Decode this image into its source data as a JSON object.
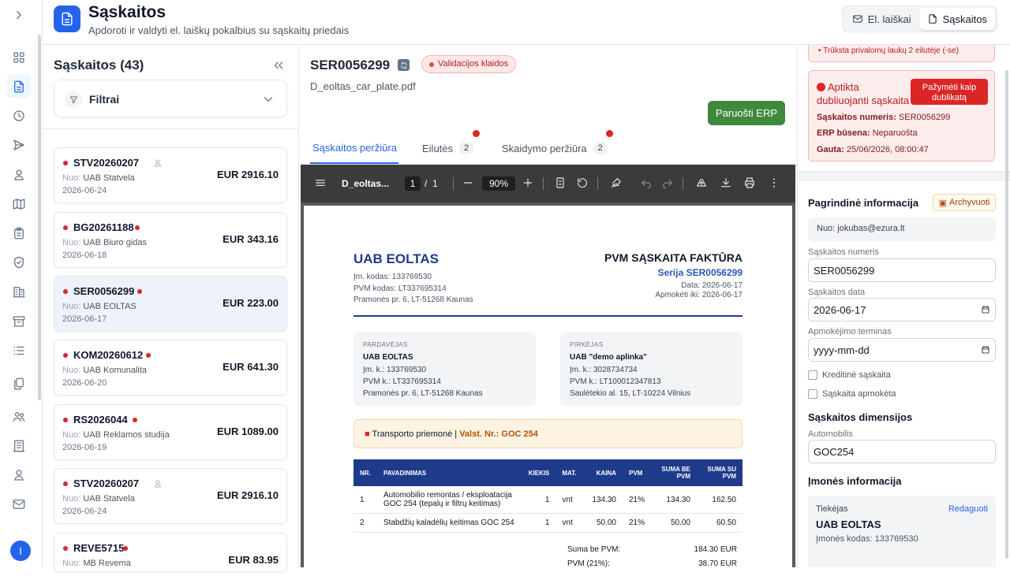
{
  "header": {
    "title": "Sąskaitos",
    "subtitle": "Apdoroti ir valdyti el. laiškų pokalbius su sąskaitų priedais",
    "tabs": [
      "El. laiškai",
      "Sąskaitos"
    ]
  },
  "rail": {
    "icons": [
      "expand-chevron",
      "dashboard",
      "invoices",
      "history",
      "send",
      "user",
      "map",
      "clipboard",
      "shield",
      "buildings",
      "archive",
      "list",
      "documents",
      "users",
      "building",
      "user",
      "mail",
      "menu"
    ],
    "avatar": "I"
  },
  "list": {
    "title": "Sąskaitos (43)",
    "filters": "Filtrai",
    "from_key": "Nuo:",
    "items": [
      {
        "num": "STV20260207",
        "from": "UAB Statvela",
        "date": "2026-06-24",
        "amount": "EUR 2916.10",
        "user": true
      },
      {
        "num": "BG20261188",
        "from": "UAB Biuro gidas",
        "date": "2026-06-18",
        "amount": "EUR 343.16"
      },
      {
        "num": "SER0056299",
        "from": "UAB EOLTAS",
        "date": "2026-06-17",
        "amount": "EUR 223.00",
        "selected": true
      },
      {
        "num": "KOM20260612",
        "from": "UAB Komunalita",
        "date": "2026-06-20",
        "amount": "EUR 641.30"
      },
      {
        "num": "RS2026044",
        "from": "UAB Reklamos studija",
        "date": "2026-06-19",
        "amount": "EUR 1089.00"
      },
      {
        "num": "STV20260207",
        "from": "UAB Statvela",
        "date": "2026-06-24",
        "amount": "EUR 2916.10",
        "user": true
      },
      {
        "num": "REVE5715",
        "from": "MB Revema",
        "date": "",
        "amount": "EUR 83.95"
      }
    ]
  },
  "invoice": {
    "number": "SER0056299",
    "status": "Validacijos klaidos",
    "file": "D_eoltas_car_plate.pdf",
    "erp_button": "Paruošti ERP",
    "tabs": [
      {
        "label": "Sąskaitos peržiūra"
      },
      {
        "label": "Eilutės",
        "count": "2"
      },
      {
        "label": "Skaidymo peržiūra",
        "count": "2"
      }
    ]
  },
  "pdf": {
    "name": "D_eoltas...",
    "page": "1",
    "sep": "/",
    "pages": "1",
    "zoom": "90%",
    "seller_name": "UAB EOLTAS",
    "seller_lines": [
      "Įm. kodas: 133769530",
      "PVM kodas: LT337695314",
      "Pramonės pr. 6, LT-51268 Kaunas"
    ],
    "doc_title": "PVM SĄSKAITA FAKTŪRA",
    "series": "Serija SER0056299",
    "doc_lines": [
      "Data: 2026-06-17",
      "Apmokėti iki: 2026-06-17"
    ],
    "seller_box": {
      "head": "PARDAVĖJAS",
      "name": "UAB EOLTAS",
      "lines": [
        "Įm. k.: 133769530",
        "PVM k.: LT337695314",
        "Pramonės pr. 6, LT-51268 Kaunas"
      ]
    },
    "buyer_box": {
      "head": "PIRKĖJAS",
      "name": "UAB \"demo aplinka\"",
      "lines": [
        "Įm. k.: 3028734734",
        "PVM k.: LT100012347813",
        "Saulėtekio al. 15, LT-10224 Vilnius"
      ]
    },
    "vehicle_label": "Transporto priemonė",
    "vehicle_sep": "|",
    "vehicle_plate": "Valst. Nr.: GOC 254",
    "columns": [
      "NR.",
      "PAVADINIMAS",
      "KIEKIS",
      "MAT.",
      "KAINA",
      "PVM",
      "SUMA BE PVM",
      "SUMA SU PVM"
    ],
    "rows": [
      [
        "1",
        "Automobilio remontas / eksploatacija GOC 254 (tepalų ir filtrų keitimas)",
        "1",
        "vnt",
        "134.30",
        "21%",
        "134.30",
        "162.50"
      ],
      [
        "2",
        "Stabdžių kaladėlių keitimas GOC 254",
        "1",
        "vnt",
        "50.00",
        "21%",
        "50.00",
        "60.50"
      ]
    ],
    "totals": [
      {
        "label": "Suma be PVM:",
        "value": "184.30 EUR"
      },
      {
        "label": "PVM (21%):",
        "value": "38.70 EUR"
      }
    ]
  },
  "right": {
    "missing": "Trūksta privalomų laukų 2 eilutėje (-se)",
    "dup_title": "Aptikta dubliuojanti sąskaita",
    "dup_button": "Pažymėti kaip dublikatą",
    "dup_rows": [
      {
        "k": "Sąskaitos numeris:",
        "v": "SER0056299"
      },
      {
        "k": "ERP būsena:",
        "v": "Neparuošta"
      },
      {
        "k": "Gauta:",
        "v": "25/06/2026, 08:00:47"
      }
    ],
    "main_info": "Pagrindinė informacija",
    "archive": "Archyvuoti",
    "from": "Nuo: jokubas@ezura.lt",
    "num_label": "Sąskaitos numeris",
    "num_value": "SER0056299",
    "date_label": "Sąskaitos data",
    "date_value": "2026-06-17",
    "term_label": "Apmokėjimo terminas",
    "term_value": "yyyy-mm-dd",
    "credit": "Kreditinė sąskaita",
    "paid": "Sąskaita apmokėta",
    "dims": "Sąskaitos dimensijos",
    "car_label": "Automobilis",
    "car_value": "GOC254",
    "company": "Įmonės informacija",
    "supplier": "Tiekėjas",
    "edit": "Redaguoti",
    "sup_name": "UAB EOLTAS",
    "sup_code": "Įmonės kodas: 133769530"
  },
  "colors": {
    "accent": "#2563eb",
    "error": "#dc2626",
    "erp": "#3f8a3a",
    "pdf_header": "#1e3a8a"
  }
}
